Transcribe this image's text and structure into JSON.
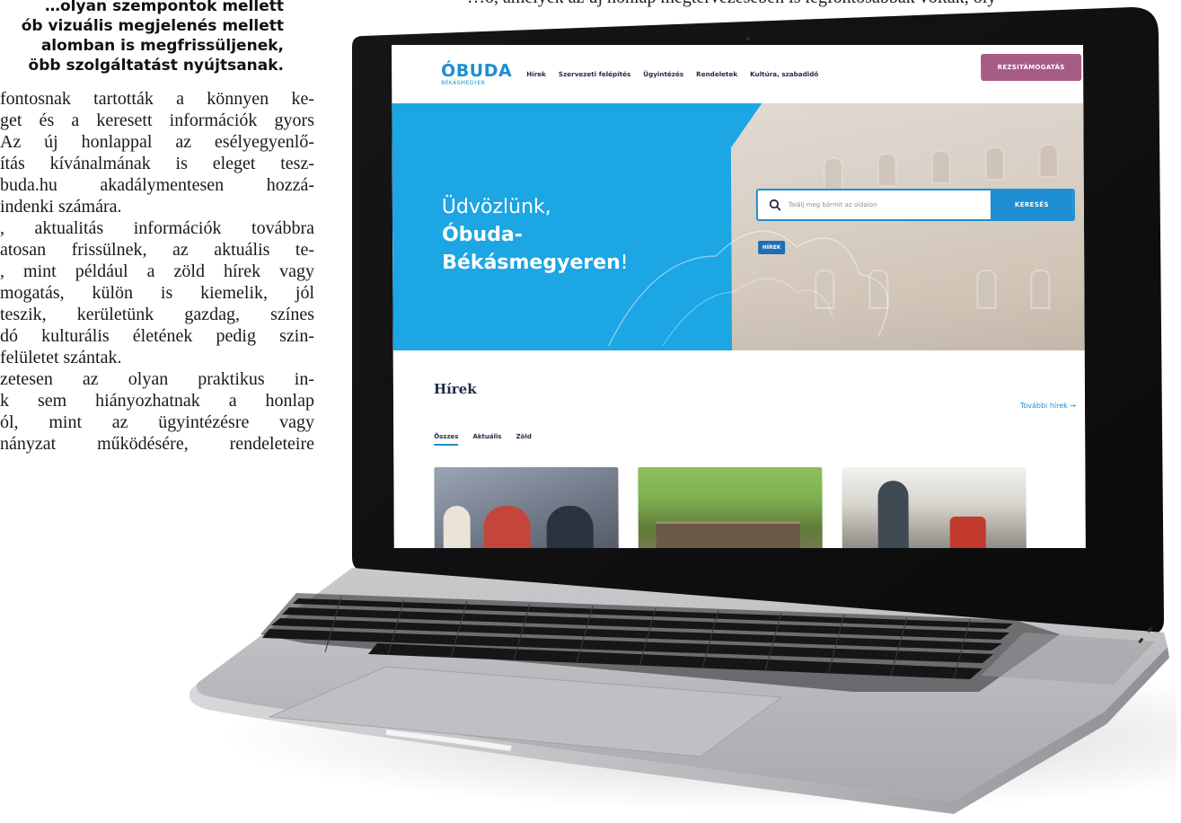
{
  "article": {
    "lead_lines": [
      "…olyan szempontok mellett",
      "ób vizuális megjelenés mellett",
      "alomban is megfrissüljenek,",
      "öbb szolgáltatást nyújtsanak."
    ],
    "top_fragment": "…ó, amelyek az új honlap megtervezésében is legfontosabbak voltak, oly",
    "body_lines": [
      "fontosnak tartották a könnyen ke-",
      "get és a keresett információk gyors",
      "Az új honlappal az esélyegyenlő-",
      "ítás kívánalmának is eleget tesz-",
      "buda.hu akadálymentesen hozzá-",
      "indenki számára.",
      ", aktualitás információk továbbra",
      "atosan frissülnek, az aktuális te-",
      ", mint például a zöld hírek vagy",
      "mogatás, külön is kiemelik, jól",
      "teszik, kerületünk gazdag, színes",
      "dó kulturális életének pedig szin-",
      "felületet szántak.",
      "zetesen az olyan praktikus in-",
      "k sem hiányozhatnak a honlap",
      "ól, mint az ügyintézésre vagy",
      "nányzat működésére, rendeleteire"
    ]
  },
  "site": {
    "logo": {
      "main": "ÓBUDA",
      "sub": "BÉKÁSMEGYER"
    },
    "nav": [
      "Hírek",
      "Szervezeti felépítés",
      "Ügyintézés",
      "Rendeletek",
      "Kultúra, szabadidő"
    ],
    "cta": "REZSITÁMOGATÁS",
    "hero": {
      "line1": "Üdvözlünk,",
      "line2": "Óbuda-",
      "line3": "Békásmegyeren",
      "line3_suffix": "!"
    },
    "search": {
      "placeholder": "Találj meg bármit az oldalon",
      "button": "KERESÉS"
    },
    "tag": "HÍREK",
    "news": {
      "title": "Hírek",
      "more": "További hírek →",
      "tabs": [
        "Összes",
        "Aktuális",
        "Zöld"
      ],
      "active_tab": "Összes"
    }
  },
  "colors": {
    "brand_blue": "#1d8fd2",
    "hero_blue": "#1ca6e3",
    "cta_purple": "#a75c86",
    "navy": "#1f2a44"
  }
}
